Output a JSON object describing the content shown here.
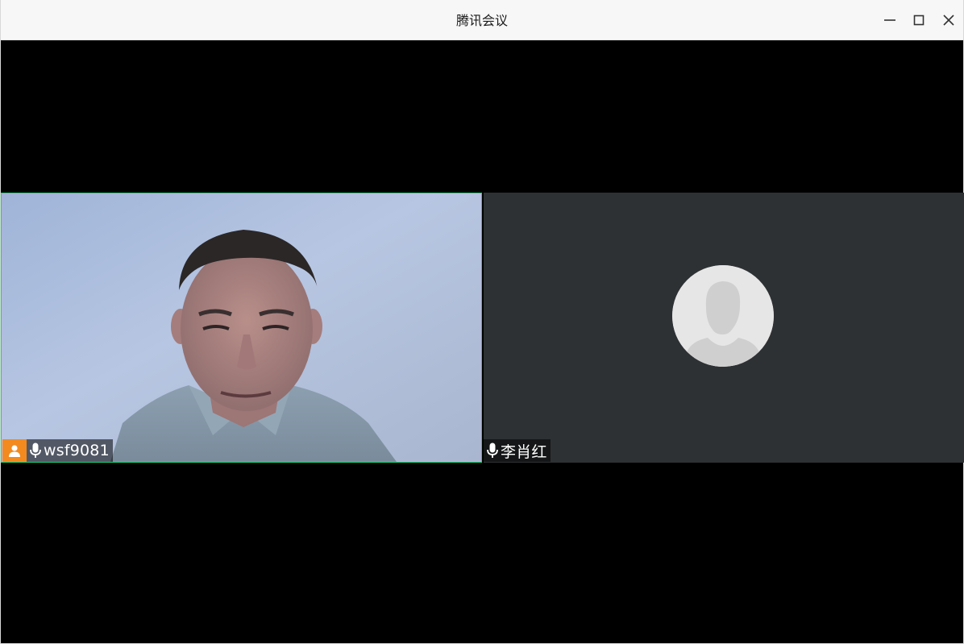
{
  "window": {
    "title": "腾讯会议",
    "controls": [
      "minimize-icon",
      "maximize-icon",
      "close-icon"
    ]
  },
  "participants": [
    {
      "name": "wsf9081",
      "role": "host",
      "video_on": true,
      "mic_icon": "microphone-icon",
      "active_speaker_border": "#1fd27a",
      "host_badge_color": "#f28a1f"
    },
    {
      "name": "李肖红",
      "video_on": false,
      "mic_icon": "microphone-icon",
      "avatar_icon": "default-user-avatar-icon",
      "tile_background": "#2e3134"
    }
  ]
}
